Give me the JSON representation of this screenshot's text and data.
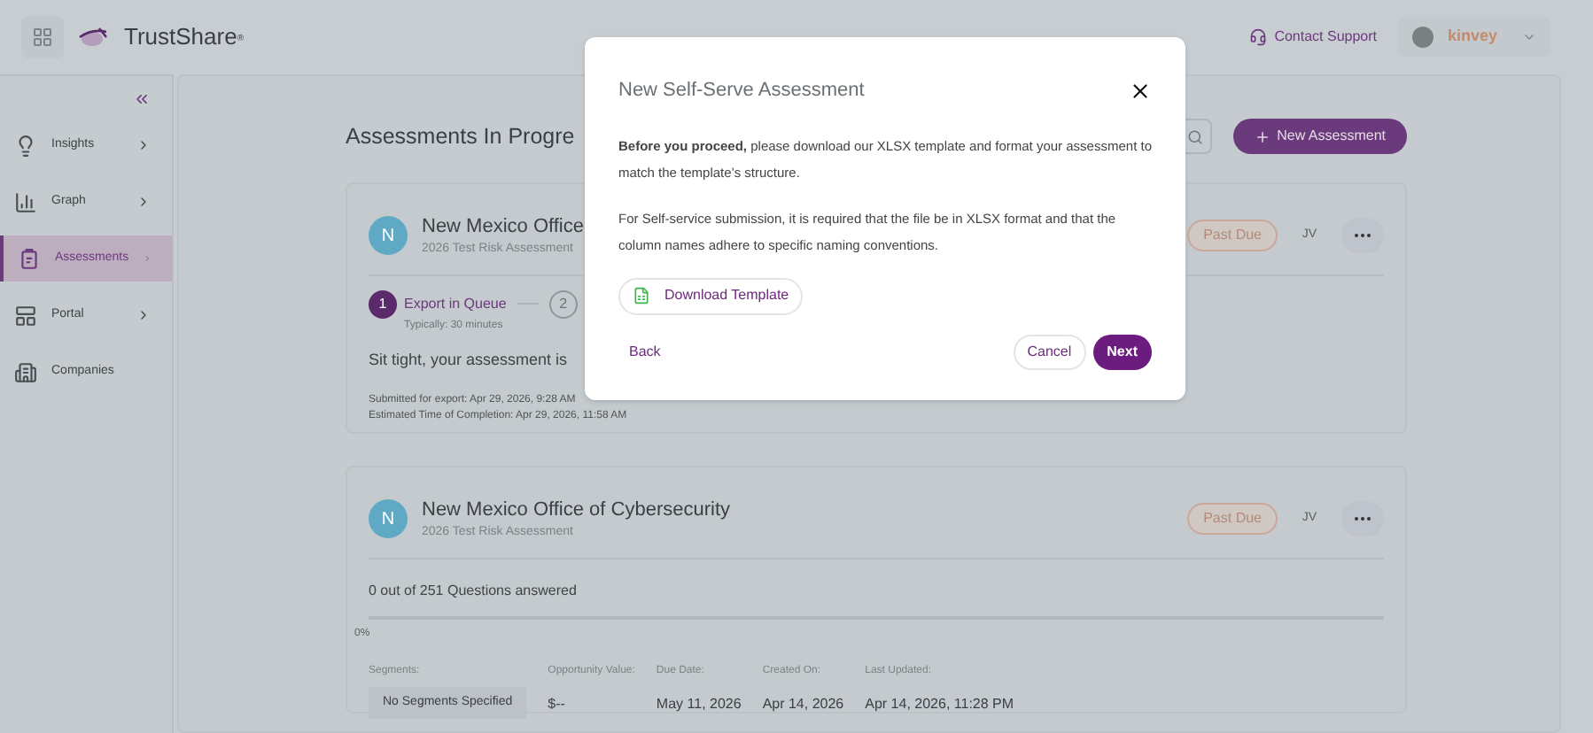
{
  "header": {
    "brand": "TrustShare",
    "brand_mark": "®",
    "contact": "Contact Support",
    "org": "kinvey"
  },
  "sidebar": {
    "items": [
      {
        "label": "Insights",
        "arrow": true,
        "selected": false
      },
      {
        "label": "Graph",
        "arrow": true,
        "selected": false
      },
      {
        "label": "Assessments",
        "arrow": true,
        "selected": true
      },
      {
        "label": "Portal",
        "arrow": true,
        "selected": false
      },
      {
        "label": "Companies",
        "arrow": false,
        "selected": false
      }
    ]
  },
  "main": {
    "heading": "Assessments In Progre",
    "new_button": "New Assessment"
  },
  "cards": [
    {
      "kind": "export",
      "avatar": "N",
      "title": "New Mexico Office",
      "subtitle": "2026 Test Risk Assessment",
      "badge": "Past Due",
      "assignee": "JV",
      "step_number": "1",
      "step_label": "Export in Queue",
      "step_hint": "Typically: 30 minutes",
      "next_step": "2",
      "message": "Sit tight, your assessment is",
      "submitted": "Submitted for export: Apr 29, 2026, 9:28 AM",
      "eta": "Estimated Time of Completion: Apr 29, 2026, 11:58 AM"
    },
    {
      "kind": "progress",
      "avatar": "N",
      "title": "New Mexico Office of Cybersecurity",
      "subtitle": "2026 Test Risk Assessment",
      "badge": "Past Due",
      "assignee": "JV",
      "answered": "0 out of 251 Questions answered",
      "level": 0,
      "percent": "0%",
      "fields": [
        {
          "label": "Segments:",
          "value": "No Segments Specified",
          "kind": "chip"
        },
        {
          "label": "Opportunity Value:",
          "value": "$--",
          "kind": "text"
        },
        {
          "label": "Due Date:",
          "value": "May 11, 2026",
          "kind": "text"
        },
        {
          "label": "Created On:",
          "value": "Apr 14, 2026",
          "kind": "text"
        },
        {
          "label": "Last Updated:",
          "value": "Apr 14, 2026, 11:28 PM",
          "kind": "text"
        }
      ]
    }
  ],
  "dialog": {
    "title": "New Self-Serve Assessment",
    "paragraphs": [
      "**Before you proceed,** please download our XLSX template and format your assessment to match the template’s structure.",
      "For Self-service submission, it is required that the file be in XLSX format and that the column names adhere to specific naming conventions."
    ],
    "download": "Download Template",
    "back": "Back",
    "cancel": "Cancel",
    "next": "Next"
  }
}
